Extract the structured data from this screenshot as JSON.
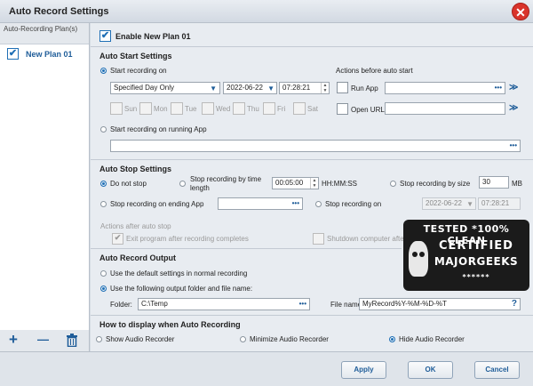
{
  "window": {
    "title": "Auto Record Settings",
    "close_glyph": "✕"
  },
  "sidebar": {
    "header": "Auto-Recording Plan(s)",
    "items": [
      {
        "label": "New Plan 01",
        "checked": true
      }
    ],
    "footer": {
      "add_glyph": "+",
      "remove_glyph": "—",
      "delete_icon": "trash-icon"
    }
  },
  "plan": {
    "enable_label": "Enable New Plan 01",
    "enabled": true
  },
  "auto_start": {
    "title": "Auto Start Settings",
    "start_recording_on_label": "Start recording on",
    "schedule_type": "Specified Day Only",
    "date": "2022-06-22",
    "time": "07:28:21",
    "days": [
      "Sun",
      "Mon",
      "Tue",
      "Wed",
      "Thu",
      "Fri",
      "Sat"
    ],
    "actions_title": "Actions before auto start",
    "run_app_label": "Run App",
    "open_url_label": "Open URL",
    "running_app_label": "Start recording on running App",
    "dots": "•••",
    "go_glyph": "≫"
  },
  "auto_stop": {
    "title": "Auto Stop Settings",
    "do_not_stop_label": "Do not stop",
    "by_time_label": "Stop recording by time length",
    "time_length": "00:05:00",
    "time_format": "HH:MM:SS",
    "by_size_label": "Stop recording by size",
    "size_value": "30",
    "size_unit": "MB",
    "ending_app_label": "Stop recording on ending App",
    "stop_on_label": "Stop recording on",
    "stop_date": "2022-06-22",
    "stop_time": "07:28:21",
    "after_title": "Actions after auto stop",
    "exit_label": "Exit program after recording completes",
    "shutdown_label": "Shutdown computer after recording completes"
  },
  "output": {
    "title": "Auto Record Output",
    "default_label": "Use the default settings in normal recording",
    "custom_label": "Use the following output folder and file name:",
    "folder_label": "Folder:",
    "folder_value": "C:\\Temp",
    "filename_label": "File name:",
    "filename_value": "MyRecord%Y-%M-%D-%T",
    "help_glyph": "?"
  },
  "display": {
    "title": "How to display when Auto Recording",
    "show_label": "Show Audio Recorder",
    "minimize_label": "Minimize Audio Recorder",
    "hide_label": "Hide Audio Recorder"
  },
  "buttons": {
    "apply": "Apply",
    "ok": "OK",
    "cancel": "Cancel"
  },
  "watermark": {
    "line1": "TESTED *100% CLEAN",
    "line2": "CERTIFIED",
    "line3": "MAJORGEEKS",
    "line4": "******"
  },
  "colors": {
    "accent": "#1f6fb5",
    "close": "#d9342b"
  }
}
